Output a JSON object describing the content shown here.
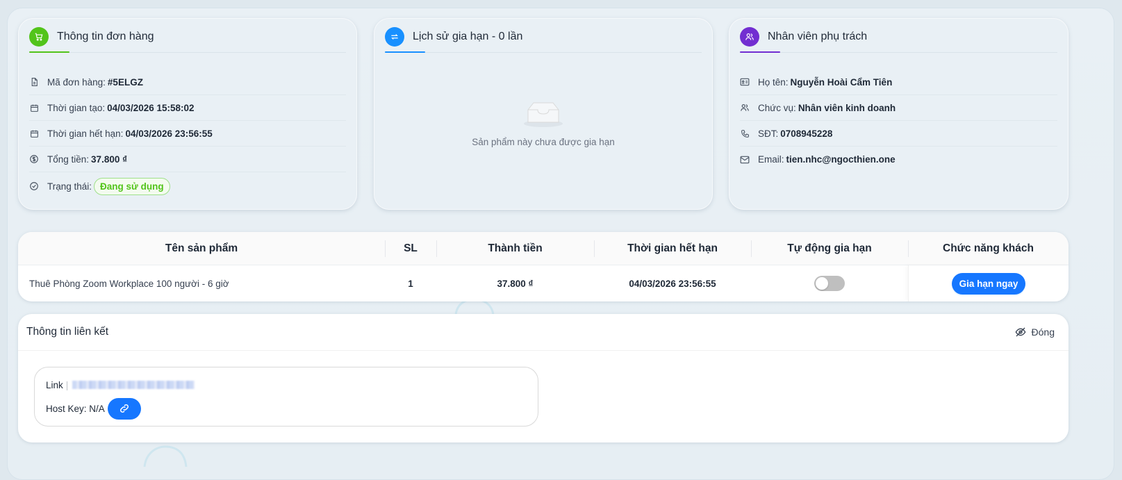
{
  "order_card": {
    "title": "Thông tin đơn hàng",
    "accent": "#52c41a",
    "rows": [
      {
        "label": "Mã đơn hàng:",
        "value": "#5ELGZ",
        "icon": "file-icon"
      },
      {
        "label": "Thời gian tạo:",
        "value": "04/03/2026 15:58:02",
        "icon": "calendar-icon"
      },
      {
        "label": "Thời gian hết hạn:",
        "value": "04/03/2026 23:56:55",
        "icon": "calendar-icon"
      },
      {
        "label": "Tổng tiền:",
        "value": "37.800 ₫",
        "icon": "dollar-icon"
      }
    ],
    "status_label": "Trạng thái:",
    "status_value": "Đang sử dụng"
  },
  "history_card": {
    "title": "Lịch sử gia hạn - 0 lần",
    "accent": "#1890ff",
    "empty_text": "Sản phẩm này chưa được gia hạn"
  },
  "staff_card": {
    "title": "Nhân viên phụ trách",
    "accent": "#722ed1",
    "rows": [
      {
        "label": "Họ tên:",
        "value": "Nguyễn Hoài Cẩm Tiên",
        "icon": "id-card-icon"
      },
      {
        "label": "Chức vụ:",
        "value": "Nhân viên kinh doanh",
        "icon": "users-icon"
      },
      {
        "label": "SĐT:",
        "value": "0708945228",
        "icon": "phone-icon"
      },
      {
        "label": "Email:",
        "value": "tien.nhc@ngocthien.one",
        "icon": "mail-icon"
      }
    ]
  },
  "table": {
    "headers": [
      "Tên sản phẩm",
      "SL",
      "Thành tiền",
      "Thời gian hết hạn",
      "Tự động gia hạn",
      "Chức năng khách"
    ],
    "row": {
      "product": "Thuê Phòng Zoom Workplace 100 người - 6 giờ",
      "qty": "1",
      "amount": "37.800 ₫",
      "expiry": "04/03/2026 23:56:55",
      "auto_renew": false,
      "action_label": "Gia hạn ngay"
    }
  },
  "link_panel": {
    "title": "Thông tin liên kết",
    "close_label": "Đóng",
    "link_label": "Link",
    "host_key_label": "Host Key: N/A"
  }
}
